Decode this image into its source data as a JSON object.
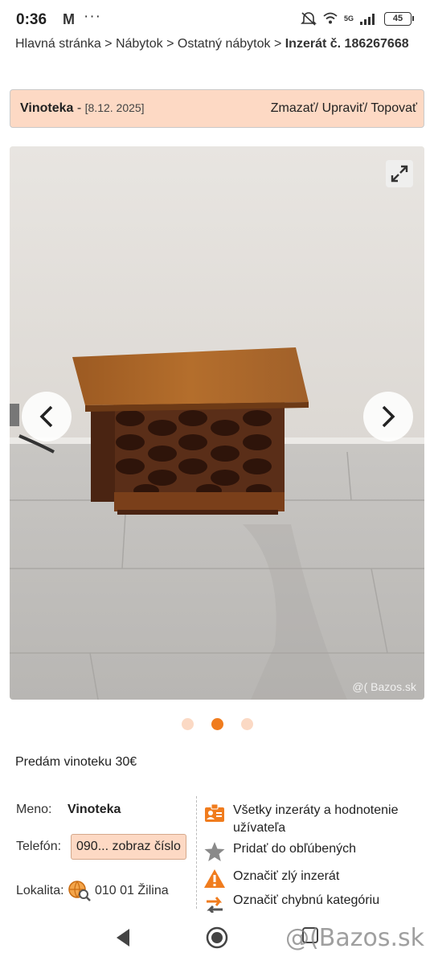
{
  "status_bar": {
    "time": "0:36",
    "mail_icon": "M",
    "more_icon": "···",
    "network": "5G",
    "battery": "45"
  },
  "breadcrumb": {
    "path": "Hlavná stránka > Nábytok > Ostatný nábytok > ",
    "current": "Inzerát č. 186267668"
  },
  "listing": {
    "title": "Vinoteka",
    "date_sep": " - ",
    "date": "[8.12. 2025]",
    "actions": [
      "Zmazať/",
      " Upraviť/",
      " Topovať"
    ]
  },
  "gallery": {
    "watermark": "@( Bazos.sk",
    "dot_count": 3,
    "active_index": 1
  },
  "description": "Predám vinoteku 30€",
  "seller": {
    "name_label": "Meno:",
    "name": "Vinoteka",
    "phone_label": "Telefón:",
    "phone_button": "090... zobraz číslo",
    "location_label": "Lokalita:",
    "location": "010 01 Žilina"
  },
  "actions_panel": {
    "all_listings": "Všetky inzeráty a hodnotenie užívateľa",
    "add_favorite": "Pridať do obľúbených",
    "report": "Označiť zlý inzerát",
    "wrong_category": "Označiť chybnú kategóriu"
  },
  "footer": {
    "logo": "@(Bazos.sk"
  },
  "colors": {
    "accent": "#f07c1e",
    "header_bg": "#fdd9c4"
  }
}
